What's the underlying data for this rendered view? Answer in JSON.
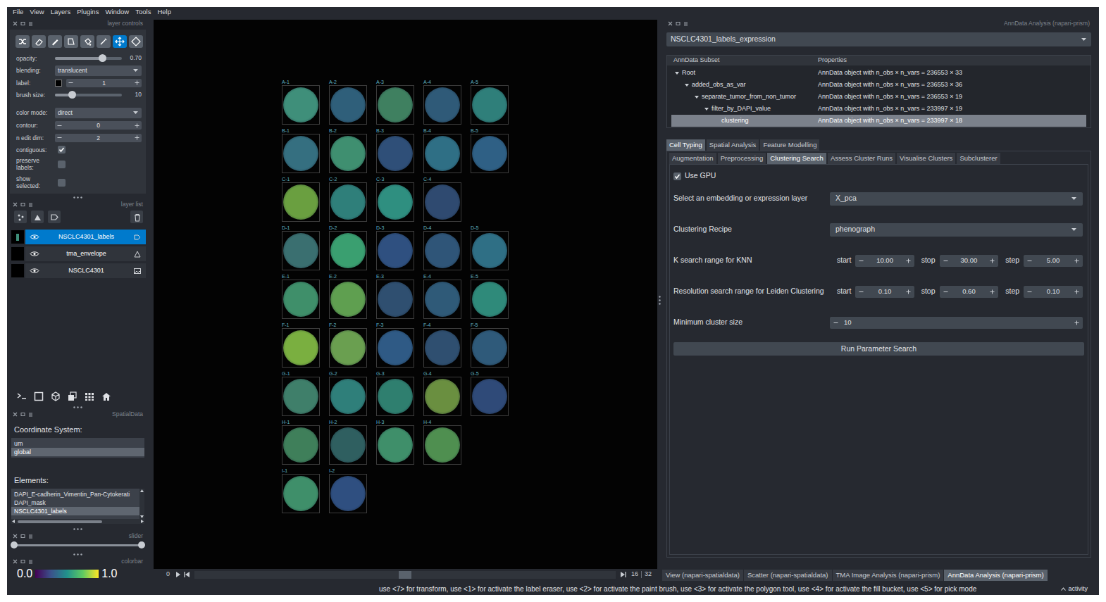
{
  "menu": [
    "File",
    "View",
    "Layers",
    "Plugins",
    "Window",
    "Tools",
    "Help"
  ],
  "layer_controls": {
    "title": "layer controls",
    "tools": [
      {
        "kind": "shuffle",
        "selected": false
      },
      {
        "kind": "erase",
        "selected": false
      },
      {
        "kind": "paint",
        "selected": false
      },
      {
        "kind": "polygon",
        "selected": false
      },
      {
        "kind": "fill",
        "selected": false
      },
      {
        "kind": "picker",
        "selected": false
      },
      {
        "kind": "pan",
        "selected": true
      },
      {
        "kind": "transform",
        "selected": false
      }
    ],
    "controls": [
      {
        "label": "opacity:",
        "kind": "slider",
        "value": "0.70",
        "level": 0.7
      },
      {
        "label": "blending:",
        "kind": "dropdown",
        "value": "translucent"
      },
      {
        "label": "label:",
        "kind": "label_spinner",
        "value": "1"
      },
      {
        "label": "brush size:",
        "kind": "slider",
        "value": "10",
        "level": 0.25
      },
      {
        "label": "color mode:",
        "kind": "dropdown",
        "value": "direct"
      },
      {
        "label": "contour:",
        "kind": "spinner",
        "value": "0"
      },
      {
        "label": "n edit dim:",
        "kind": "spinner",
        "value": "2"
      },
      {
        "label": "contiguous:",
        "kind": "checkbox",
        "checked": true
      },
      {
        "label": "preserve labels:",
        "kind": "checkbox",
        "checked": false
      },
      {
        "label": "show selected:",
        "kind": "checkbox",
        "checked": false
      }
    ]
  },
  "layer_list": {
    "title": "layer list",
    "layers": [
      {
        "name": "NSCLC4301_labels",
        "kind": "labels",
        "visible": true,
        "selected": true
      },
      {
        "name": "tma_envelope",
        "kind": "shapes",
        "visible": true,
        "selected": false
      },
      {
        "name": "NSCLC4301",
        "kind": "image",
        "visible": true,
        "selected": false
      }
    ]
  },
  "spatialdata": {
    "title": "SpatialData",
    "coordinate_label": "Coordinate System:",
    "coordinate_systems": [
      {
        "name": "um",
        "selected": false
      },
      {
        "name": "global",
        "selected": true
      }
    ],
    "elements_label": "Elements:",
    "elements": [
      {
        "name": "DAPI_E-cadherin_Vimentin_Pan-Cytokerati",
        "selected": false
      },
      {
        "name": "DAPI_mask",
        "selected": false
      },
      {
        "name": "NSCLC4301_labels",
        "selected": true
      }
    ]
  },
  "slider_panel": {
    "title": "slider",
    "level_low": 0,
    "level_high": 1
  },
  "colorbar": {
    "title": "colorbar",
    "min": "0.0",
    "max": "1.0"
  },
  "canvas": {
    "core_rows": [
      [
        {
          "label": "A-1",
          "color": "#3f8f7a"
        },
        {
          "label": "A-2",
          "color": "#2f5f7a"
        },
        {
          "label": "A-3",
          "color": "#3f8060"
        },
        {
          "label": "A-4",
          "color": "#2f5a78"
        },
        {
          "label": "A-5",
          "color": "#2f7f7a"
        }
      ],
      [
        {
          "label": "B-1",
          "color": "#356f80"
        },
        {
          "label": "B-2",
          "color": "#3f8f70"
        },
        {
          "label": "B-3",
          "color": "#2f4f78"
        },
        {
          "label": "B-4",
          "color": "#2f6f85"
        },
        {
          "label": "B-5",
          "color": "#2f6085"
        }
      ],
      [
        {
          "label": "C-1",
          "color": "#6a9f40"
        },
        {
          "label": "C-2",
          "color": "#2f7f7a"
        },
        {
          "label": "C-3",
          "color": "#2f8f80"
        },
        {
          "label": "C-4",
          "color": "#2f4a70"
        }
      ],
      [
        {
          "label": "D-1",
          "color": "#3a6f70"
        },
        {
          "label": "D-2",
          "color": "#3a9f70"
        },
        {
          "label": "D-3",
          "color": "#2f5080"
        },
        {
          "label": "D-4",
          "color": "#2f5578"
        },
        {
          "label": "D-5",
          "color": "#2f6f85"
        }
      ],
      [
        {
          "label": "E-1",
          "color": "#3f8f6a"
        },
        {
          "label": "E-2",
          "color": "#5f9f50"
        },
        {
          "label": "E-3",
          "color": "#2f4f70"
        },
        {
          "label": "E-4",
          "color": "#2f5a78"
        },
        {
          "label": "E-5",
          "color": "#2f8a7a"
        }
      ],
      [
        {
          "label": "F-1",
          "color": "#7aaf40"
        },
        {
          "label": "F-2",
          "color": "#6a9f50"
        },
        {
          "label": "F-3",
          "color": "#2f5a85"
        },
        {
          "label": "F-4",
          "color": "#2f4f70"
        },
        {
          "label": "F-5",
          "color": "#2f5a7a"
        }
      ],
      [
        {
          "label": "G-1",
          "color": "#3f7f6a"
        },
        {
          "label": "G-2",
          "color": "#2f7f7a"
        },
        {
          "label": "G-3",
          "color": "#2f7f6f"
        },
        {
          "label": "G-4",
          "color": "#6a8f40"
        },
        {
          "label": "G-5",
          "color": "#2f4a78"
        }
      ],
      [
        {
          "label": "H-1",
          "color": "#3f7f5a"
        },
        {
          "label": "H-2",
          "color": "#2f5f60"
        },
        {
          "label": "H-3",
          "color": "#3f8f6a"
        },
        {
          "label": "H-4",
          "color": "#4f8f50"
        }
      ],
      [
        {
          "label": "I-1",
          "color": "#3f8f6a"
        },
        {
          "label": "I-2",
          "color": "#2f4f80"
        }
      ]
    ]
  },
  "dims": {
    "start": "0",
    "current": "16",
    "total": "32",
    "level": 0.5
  },
  "analysis_panel": {
    "title": "AnnData Analysis (napari-prism)",
    "dataset": "NSCLC4301_labels_expression",
    "table": {
      "columns": [
        "AnnData Subset",
        "Properties"
      ],
      "rows": [
        {
          "name": "Root",
          "properties": "AnnData object with n_obs × n_vars = 236553 × 33",
          "depth": 0,
          "kind": "branch",
          "expanded": true,
          "selected": false
        },
        {
          "name": "added_obs_as_var",
          "properties": "AnnData object with n_obs × n_vars = 236553 × 36",
          "depth": 1,
          "kind": "branch",
          "expanded": true,
          "selected": false
        },
        {
          "name": "separate_tumor_from_non_tumor",
          "properties": "AnnData object with n_obs × n_vars = 236553 × 19",
          "depth": 2,
          "kind": "branch",
          "expanded": true,
          "selected": false
        },
        {
          "name": "filter_by_DAPI_value",
          "properties": "AnnData object with n_obs × n_vars = 233997 × 19",
          "depth": 3,
          "kind": "branch",
          "expanded": true,
          "selected": false
        },
        {
          "name": "clustering",
          "properties": "AnnData object with n_obs × n_vars = 233997 × 18",
          "depth": 4,
          "kind": "leaf",
          "selected": true
        }
      ]
    },
    "tabs": [
      {
        "label": "Cell Typing",
        "selected": true
      },
      {
        "label": "Spatial Analysis",
        "selected": false
      },
      {
        "label": "Feature Modelling",
        "selected": false
      }
    ],
    "subtabs": [
      {
        "label": "Augmentation",
        "selected": false
      },
      {
        "label": "Preprocessing",
        "selected": false
      },
      {
        "label": "Clustering Search",
        "selected": true
      },
      {
        "label": "Assess Cluster Runs",
        "selected": false
      },
      {
        "label": "Visualise Clusters",
        "selected": false
      },
      {
        "label": "Subclusterer",
        "selected": false
      }
    ],
    "form": {
      "use_gpu": {
        "label": "Use GPU",
        "checked": true
      },
      "fields": [
        {
          "label": "Select an embedding or expression layer",
          "kind": "dropdown",
          "value": "X_pca"
        },
        {
          "label": "Clustering Recipe",
          "kind": "dropdown",
          "value": "phenograph"
        },
        {
          "label": "K search range for KNN",
          "kind": "range",
          "parts": [
            {
              "label": "start",
              "value": "10.00"
            },
            {
              "label": "stop",
              "value": "30.00"
            },
            {
              "label": "step",
              "value": "5.00"
            }
          ]
        },
        {
          "label": "Resolution search range for Leiden Clustering",
          "kind": "range",
          "parts": [
            {
              "label": "start",
              "value": "0.10"
            },
            {
              "label": "stop",
              "value": "0.60"
            },
            {
              "label": "step",
              "value": "0.10"
            }
          ]
        },
        {
          "label": "Minimum cluster size",
          "kind": "spinner",
          "value": "10"
        }
      ],
      "button": "Run Parameter Search"
    }
  },
  "dock_tabs": [
    {
      "label": "View (napari-spatialdata)",
      "selected": false
    },
    {
      "label": "Scatter (napari-spatialdata)",
      "selected": false
    },
    {
      "label": "TMA Image Analysis (napari-prism)",
      "selected": false
    },
    {
      "label": "AnnData Analysis (napari-prism)",
      "selected": true
    }
  ],
  "status_bar": {
    "hint": "use <7> for transform, use <1> for activate the label eraser, use <2> for activate the paint brush, use <3> for activate the polygon tool, use <4> for activate the fill bucket, use <5> for pick mode",
    "activity": "activity"
  }
}
